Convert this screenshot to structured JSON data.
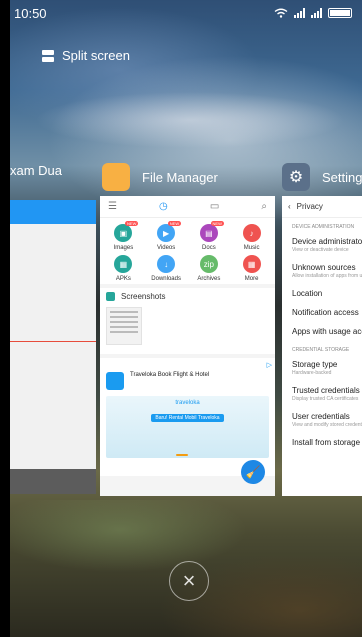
{
  "status_bar": {
    "time": "10:50"
  },
  "split_screen": {
    "label": "Split screen"
  },
  "apps": {
    "left": {
      "label": "xam Dua"
    },
    "middle": {
      "label": "File Manager"
    },
    "right": {
      "label": "Settings"
    }
  },
  "file_manager": {
    "categories": [
      {
        "label": "Images",
        "color": "#26a69a",
        "badge": "NEW"
      },
      {
        "label": "Videos",
        "color": "#42a5f5",
        "badge": "NEW"
      },
      {
        "label": "Docs",
        "color": "#ab47bc",
        "badge": "NEW"
      },
      {
        "label": "Music",
        "color": "#ef5350",
        "badge": ""
      },
      {
        "label": "APKs",
        "color": "#26a69a",
        "badge": ""
      },
      {
        "label": "Downloads",
        "color": "#42a5f5",
        "badge": ""
      },
      {
        "label": "Archives",
        "color": "#66bb6a",
        "badge": ""
      },
      {
        "label": "More",
        "color": "#ef5350",
        "badge": ""
      }
    ],
    "screenshots_label": "Screenshots",
    "ad": {
      "title": "Traveloka Book Flight & Hotel",
      "brand": "traveloka",
      "promo": "Baru! Rental Mobil Traveloka"
    }
  },
  "settings": {
    "title": "Privacy",
    "section_1": "DEVICE ADMINISTRATION",
    "items_1": [
      {
        "title": "Device administrators",
        "sub": "View or deactivate device"
      },
      {
        "title": "Unknown sources",
        "sub": "Allow installation of apps from unknown sources"
      },
      {
        "title": "Location",
        "sub": ""
      },
      {
        "title": "Notification access",
        "sub": ""
      },
      {
        "title": "Apps with usage access",
        "sub": ""
      }
    ],
    "section_2": "CREDENTIAL STORAGE",
    "items_2": [
      {
        "title": "Storage type",
        "sub": "Hardware-backed"
      },
      {
        "title": "Trusted credentials",
        "sub": "Display trusted CA certificates"
      },
      {
        "title": "User credentials",
        "sub": "View and modify stored credentials"
      },
      {
        "title": "Install from storage",
        "sub": ""
      }
    ]
  }
}
